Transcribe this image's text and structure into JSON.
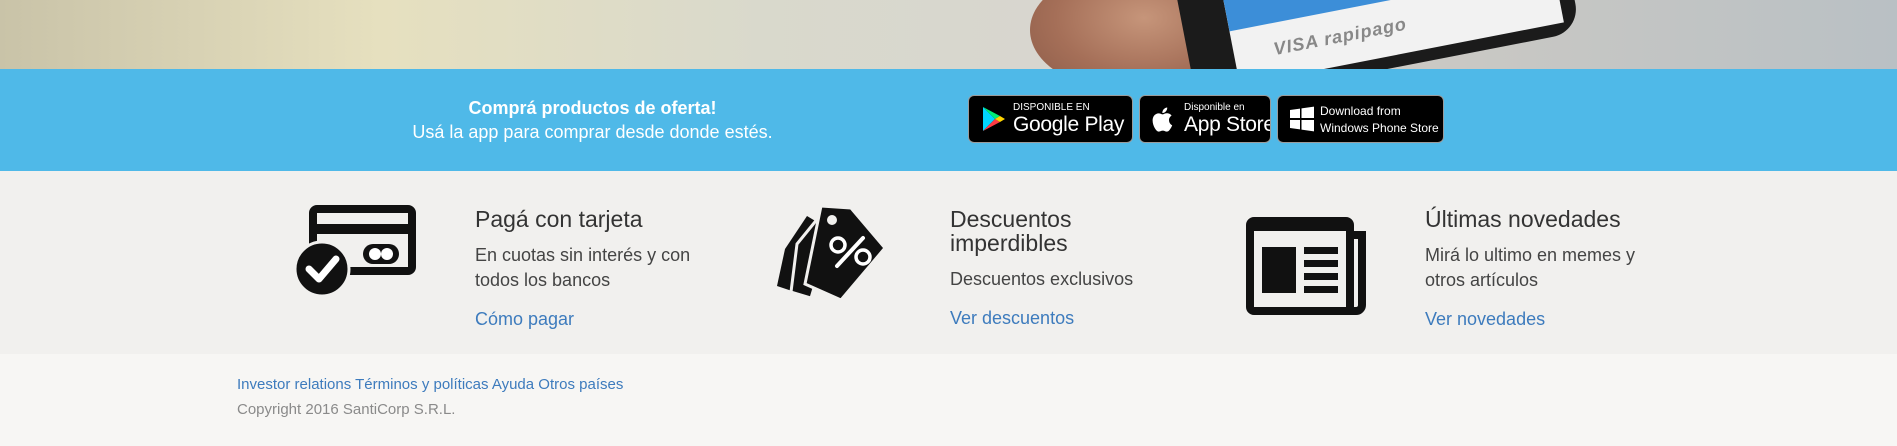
{
  "hero": {
    "logos_text": "VISA  rapipago"
  },
  "banner": {
    "title": "Comprá productos de oferta!",
    "subtitle": "Usá la app para comprar desde donde estés.",
    "stores": [
      {
        "small": "DISPONIBLE EN",
        "big": "Google Play",
        "icon": "google-play-icon"
      },
      {
        "small": "Disponible en",
        "big": "App Store",
        "icon": "apple-icon"
      },
      {
        "small": "Download from",
        "big": "Windows Phone Store",
        "icon": "windows-icon"
      }
    ]
  },
  "features": [
    {
      "icon": "credit-card-check-icon",
      "title": "Pagá con tarjeta",
      "desc": "En cuotas sin interés y con todos los bancos",
      "link": "Cómo pagar"
    },
    {
      "icon": "discount-tags-icon",
      "title": "Descuentos imperdibles",
      "desc": "Descuentos exclusivos",
      "link": "Ver descuentos"
    },
    {
      "icon": "newspaper-icon",
      "title": "Últimas novedades",
      "desc": "Mirá lo ultimo en memes y otros artículos",
      "link": "Ver novedades"
    }
  ],
  "footer": {
    "links": [
      "Investor relations",
      "Términos y políticas",
      "Ayuda",
      "Otros países"
    ],
    "copyright": "Copyright 2016 SantiCorp S.R.L."
  },
  "colors": {
    "banner_blue": "#4fb9e8",
    "link_blue": "#3d7bbd",
    "features_bg": "#f1f0ee",
    "footer_bg": "#f7f6f4"
  }
}
